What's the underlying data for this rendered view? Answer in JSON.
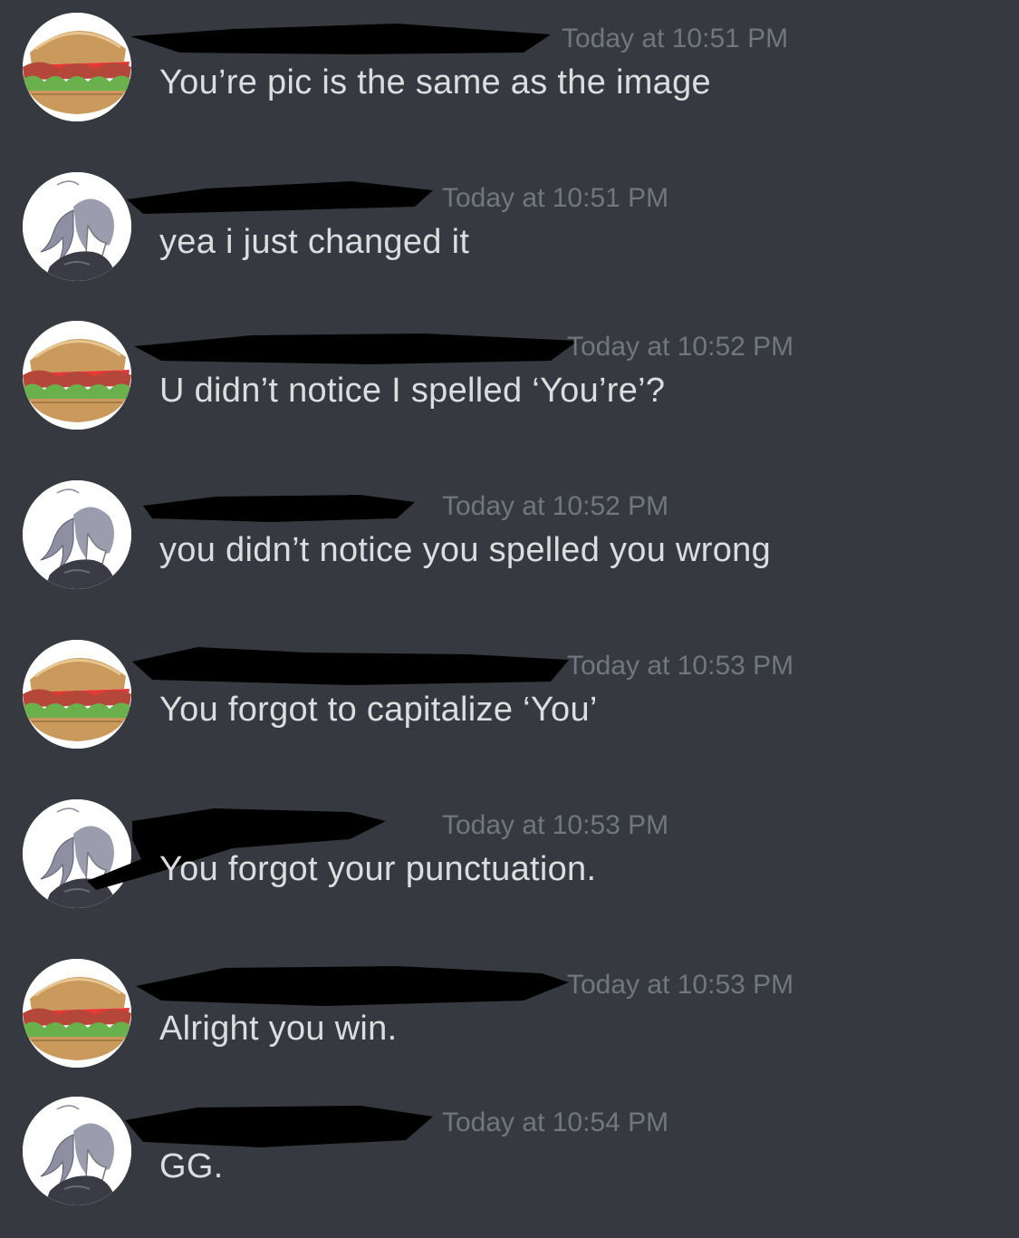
{
  "messages": [
    {
      "author_avatar": "sandwich-avatar",
      "timestamp": "Today at 10:51 PM",
      "content": "You’re pic is the same as the image"
    },
    {
      "author_avatar": "anime-girl-avatar",
      "timestamp": "Today at 10:51 PM",
      "content": "yea i just changed it"
    },
    {
      "author_avatar": "sandwich-avatar",
      "timestamp": "Today at 10:52 PM",
      "content": "U didn’t notice I spelled ‘You’re’?"
    },
    {
      "author_avatar": "anime-girl-avatar",
      "timestamp": "Today at 10:52 PM",
      "content": "you didn’t notice you spelled you wrong"
    },
    {
      "author_avatar": "sandwich-avatar",
      "timestamp": "Today at 10:53 PM",
      "content": "You forgot to capitalize ‘You’"
    },
    {
      "author_avatar": "anime-girl-avatar",
      "timestamp": "Today at 10:53 PM",
      "content": "You forgot your punctuation."
    },
    {
      "author_avatar": "sandwich-avatar",
      "timestamp": "Today at 10:53 PM",
      "content": "Alright you win."
    },
    {
      "author_avatar": "anime-girl-avatar",
      "timestamp": "Today at 10:54 PM",
      "content": "GG."
    }
  ],
  "colors": {
    "background": "#36393f",
    "timestamp": "#72767d",
    "message_text": "#dcddde",
    "username_accent": "#e91e63",
    "redaction": "#000000"
  }
}
